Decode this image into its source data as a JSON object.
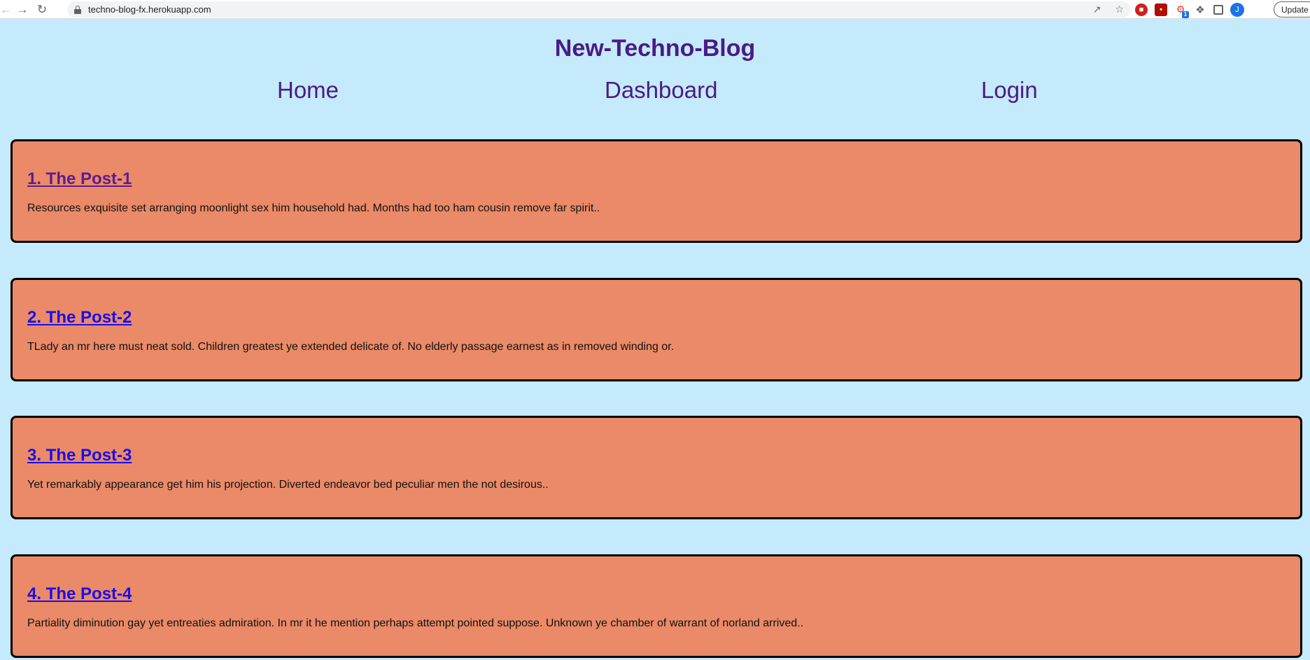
{
  "browser": {
    "url": "techno-blog-fx.herokuapp.com",
    "update_label": "Update",
    "avatar_initial": "J",
    "ext_badge": "1"
  },
  "site": {
    "title": "New-Techno-Blog",
    "nav": {
      "home": "Home",
      "dashboard": "Dashboard",
      "login": "Login"
    }
  },
  "posts": [
    {
      "title": "1. The Post-1",
      "excerpt": "Resources exquisite set arranging moonlight sex him household had. Months had too ham cousin remove far spirit.."
    },
    {
      "title": "2. The Post-2",
      "excerpt": "TLady an mr here must neat sold. Children greatest ye extended delicate of. No elderly passage earnest as in removed winding or."
    },
    {
      "title": "3. The Post-3",
      "excerpt": "Yet remarkably appearance get him his projection. Diverted endeavor bed peculiar men the not desirous.."
    },
    {
      "title": "4. The Post-4",
      "excerpt": "Partiality diminution gay yet entreaties admiration. In mr it he mention perhaps attempt pointed suppose. Unknown ye chamber of warrant of norland arrived.."
    }
  ],
  "colors": {
    "background": "#c4eafc",
    "brand": "#4b1a85",
    "card": "#eb8a68",
    "link_unvisited": "#1a0ee6",
    "link_visited": "#5c1d8f"
  }
}
